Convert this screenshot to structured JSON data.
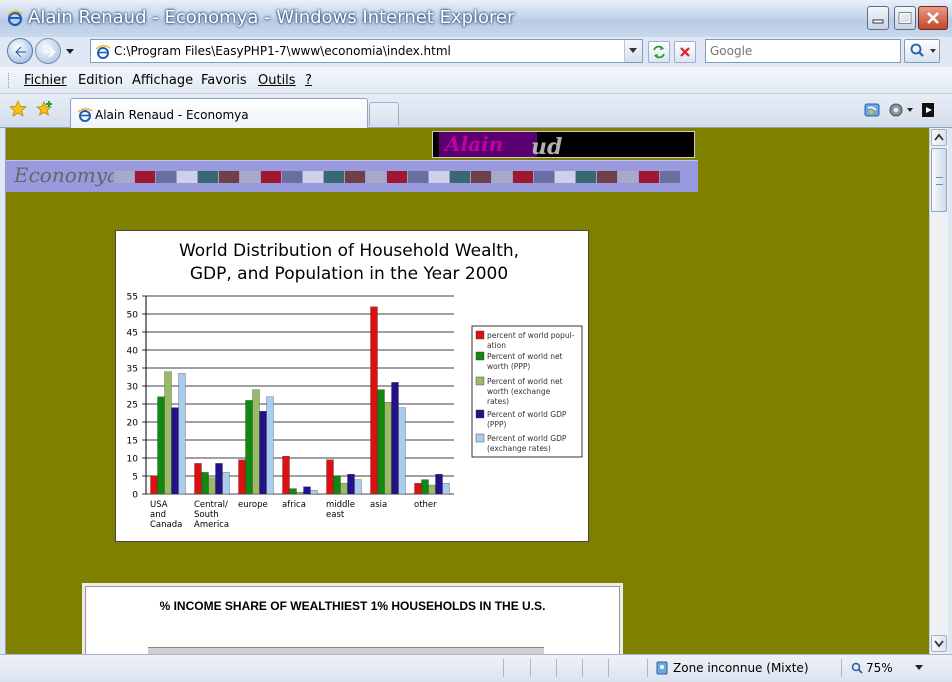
{
  "window": {
    "title": "Alain Renaud - Economya - Windows Internet Explorer"
  },
  "address": {
    "url": "C:\\Program Files\\EasyPHP1-7\\www\\economia\\index.html"
  },
  "search": {
    "placeholder": "Google"
  },
  "menu": {
    "items": [
      "Fichier",
      "Edition",
      "Affichage",
      "Favoris",
      "Outils",
      "?"
    ]
  },
  "tab": {
    "label": "Alain Renaud - Economya"
  },
  "page": {
    "logo_first": "Alain",
    "logo_last": "ud",
    "site_name": "Economya",
    "stripe_colors": [
      "#a8a8c8",
      "#a01830",
      "#6870a0",
      "#d0d0e8",
      "#386870",
      "#704048",
      "#a8a8c8",
      "#a01830",
      "#6870a0",
      "#d0d0e8",
      "#386870",
      "#704048",
      "#a8a8c8",
      "#a01830",
      "#6870a0",
      "#d0d0e8",
      "#386870",
      "#704048",
      "#a8a8c8",
      "#a01830",
      "#6870a0",
      "#d0d0e8",
      "#386870",
      "#704048",
      "#a8a8c8",
      "#a01830",
      "#6870a0"
    ],
    "income_title": "% INCOME SHARE OF WEALTHIEST 1% HOUSEHOLDS IN THE U.S."
  },
  "status": {
    "zone": "Zone inconnue (Mixte)",
    "zoom": "75%"
  },
  "chart_data": {
    "type": "bar",
    "title": [
      "World Distribution of Household Wealth,",
      "GDP, and Population in the Year 2000"
    ],
    "categories": [
      [
        "USA",
        "and",
        "Canada"
      ],
      [
        "Central/",
        "South",
        "America"
      ],
      [
        "europe"
      ],
      [
        "africa"
      ],
      [
        "middle",
        "east"
      ],
      [
        "asia"
      ],
      [
        "other"
      ]
    ],
    "ylim": [
      0,
      55
    ],
    "yticks": [
      0,
      5,
      10,
      15,
      20,
      25,
      30,
      35,
      40,
      45,
      50,
      55
    ],
    "grid": true,
    "legend_position": "right",
    "series": [
      {
        "name": "percent of world population",
        "legend_lines": [
          "percent of world popul-",
          "ation"
        ],
        "color": "#dd1111",
        "values": [
          5,
          8.5,
          9.5,
          10.5,
          9.5,
          52,
          3
        ]
      },
      {
        "name": "Percent of world net worth (PPP)",
        "legend_lines": [
          "Percent of world net",
          "worth (PPP)"
        ],
        "color": "#118811",
        "values": [
          27,
          6,
          26,
          1.5,
          5,
          29,
          4
        ]
      },
      {
        "name": "Percent of world net worth (exchange rates)",
        "legend_lines": [
          "Percent of world net",
          "worth (exchange",
          "rates)"
        ],
        "color": "#99bb66",
        "values": [
          34,
          4.5,
          29,
          0.5,
          3,
          25.5,
          2.5
        ]
      },
      {
        "name": "Percent of world GDP (PPP)",
        "legend_lines": [
          "Percent of world GDP",
          "(PPP)"
        ],
        "color": "#221188",
        "values": [
          24,
          8.5,
          23,
          2,
          5.5,
          31,
          5.5
        ]
      },
      {
        "name": "Percent of world GDP (exchange rates)",
        "legend_lines": [
          "Percent of world GDP",
          "(exchange rates)"
        ],
        "color": "#aaccee",
        "values": [
          33.5,
          6,
          27,
          1,
          4,
          24,
          3
        ]
      }
    ]
  }
}
